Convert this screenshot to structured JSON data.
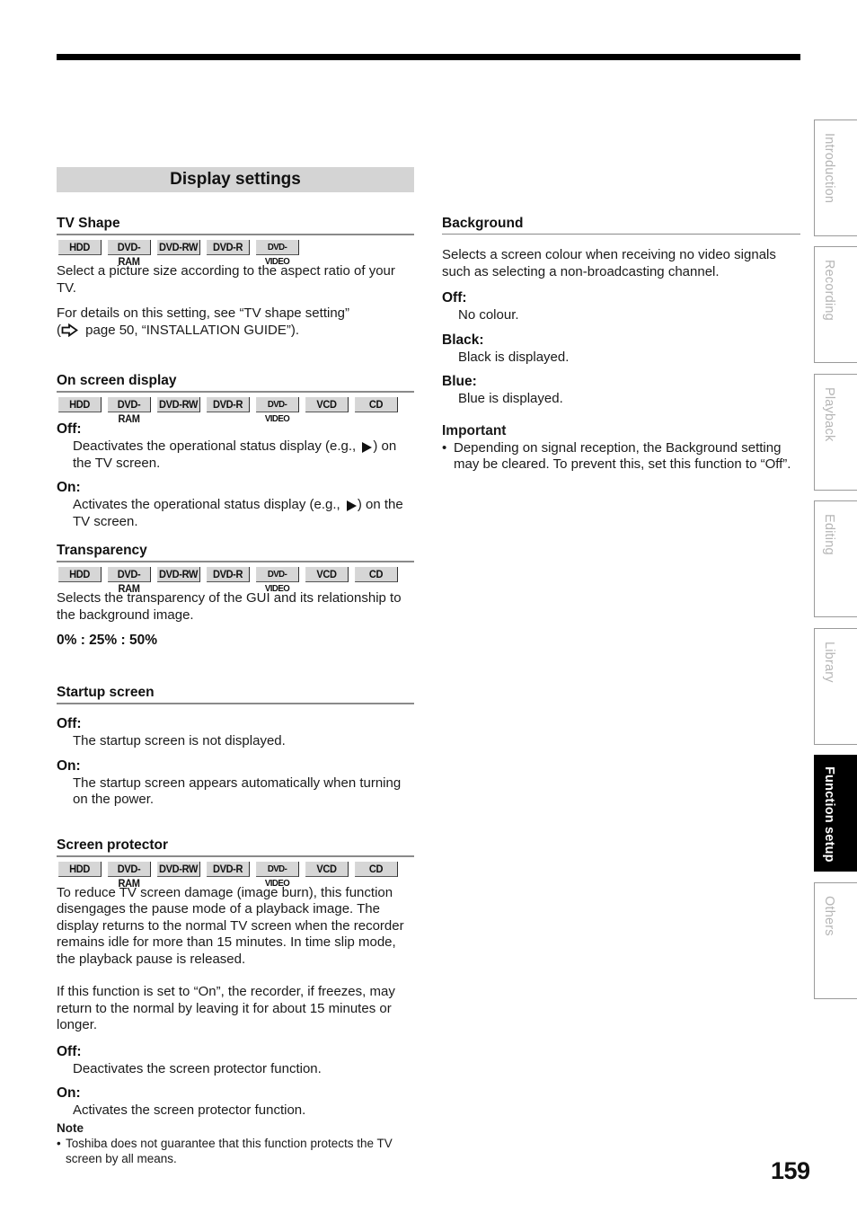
{
  "page": {
    "number": "159"
  },
  "banner": {
    "title": "Display settings"
  },
  "media_labels": [
    "HDD",
    "DVD-RAM",
    "DVD-RW",
    "DVD-R",
    "DVD-VIDEO",
    "VCD",
    "CD"
  ],
  "tv_shape": {
    "title": "TV Shape",
    "media": [
      "HDD",
      "DVD-RAM",
      "DVD-RW",
      "DVD-R",
      "DVD-VIDEO"
    ],
    "description": "Select a picture size according to the aspect ratio of your TV.",
    "details_line1": "For details on this setting, see “TV shape setting”",
    "details_ref_open": "(",
    "details_ref_icon": "page-reference-arrow-icon",
    "details_ref_text": " page 50, “INSTALLATION GUIDE”)."
  },
  "on_screen_display": {
    "title": "On screen display",
    "media": [
      "HDD",
      "DVD-RAM",
      "DVD-RW",
      "DVD-R",
      "DVD-VIDEO",
      "VCD",
      "CD"
    ],
    "off_label": "Off:",
    "off_desc_before": "Deactivates the operational status display (e.g., ",
    "off_desc_after": ") on the TV screen.",
    "on_label": "On:",
    "on_desc_before": "Activates the operational status display (e.g., ",
    "on_desc_after": ") on the TV screen.",
    "status_icon": "play-icon"
  },
  "transparency": {
    "title": "Transparency",
    "media": [
      "HDD",
      "DVD-RAM",
      "DVD-RW",
      "DVD-R",
      "DVD-VIDEO",
      "VCD",
      "CD"
    ],
    "description": "Selects the transparency of the GUI and its relationship to the background image.",
    "values": "0% : 25% : 50%"
  },
  "startup_screen": {
    "title": "Startup screen",
    "off_label": "Off:",
    "off_desc": "The startup screen is not displayed.",
    "on_label": "On:",
    "on_desc": "The startup screen appears automatically when turning on the power."
  },
  "screen_protector": {
    "title": "Screen protector",
    "media": [
      "HDD",
      "DVD-RAM",
      "DVD-RW",
      "DVD-R",
      "DVD-VIDEO",
      "VCD",
      "CD"
    ],
    "description1": "To reduce TV screen damage (image burn), this function disengages the pause mode of a playback image. The display returns to the normal TV screen when the recorder remains idle for more than 15 minutes. In time slip mode, the playback pause is released.",
    "description2": "If this function is set to “On”, the recorder, if freezes, may return to the normal by leaving it for about 15 minutes or longer.",
    "off_label": "Off:",
    "off_desc": "Deactivates the screen protector function.",
    "on_label": "On:",
    "on_desc": "Activates the screen protector function.",
    "note_title": "Note",
    "note_items": [
      "Toshiba does not guarantee that this function protects the TV screen by all means."
    ]
  },
  "background": {
    "title": "Background",
    "description": "Selects a screen colour when receiving no video signals such as selecting a non-broadcasting channel.",
    "options": [
      {
        "label": "Off:",
        "desc": "No colour."
      },
      {
        "label": "Black:",
        "desc": "Black is displayed."
      },
      {
        "label": "Blue:",
        "desc": "Blue is displayed."
      }
    ],
    "important_title": "Important",
    "important_items": [
      "Depending on signal reception, the Background setting may be cleared. To prevent this, set this function to “Off”."
    ]
  },
  "side_tabs": [
    {
      "label": "Introduction",
      "active": false
    },
    {
      "label": "Recording",
      "active": false
    },
    {
      "label": "Playback",
      "active": false
    },
    {
      "label": "Editing",
      "active": false
    },
    {
      "label": "Library",
      "active": false
    },
    {
      "label": "Function setup",
      "active": true
    },
    {
      "label": "Others",
      "active": false
    }
  ],
  "bullet": "•"
}
